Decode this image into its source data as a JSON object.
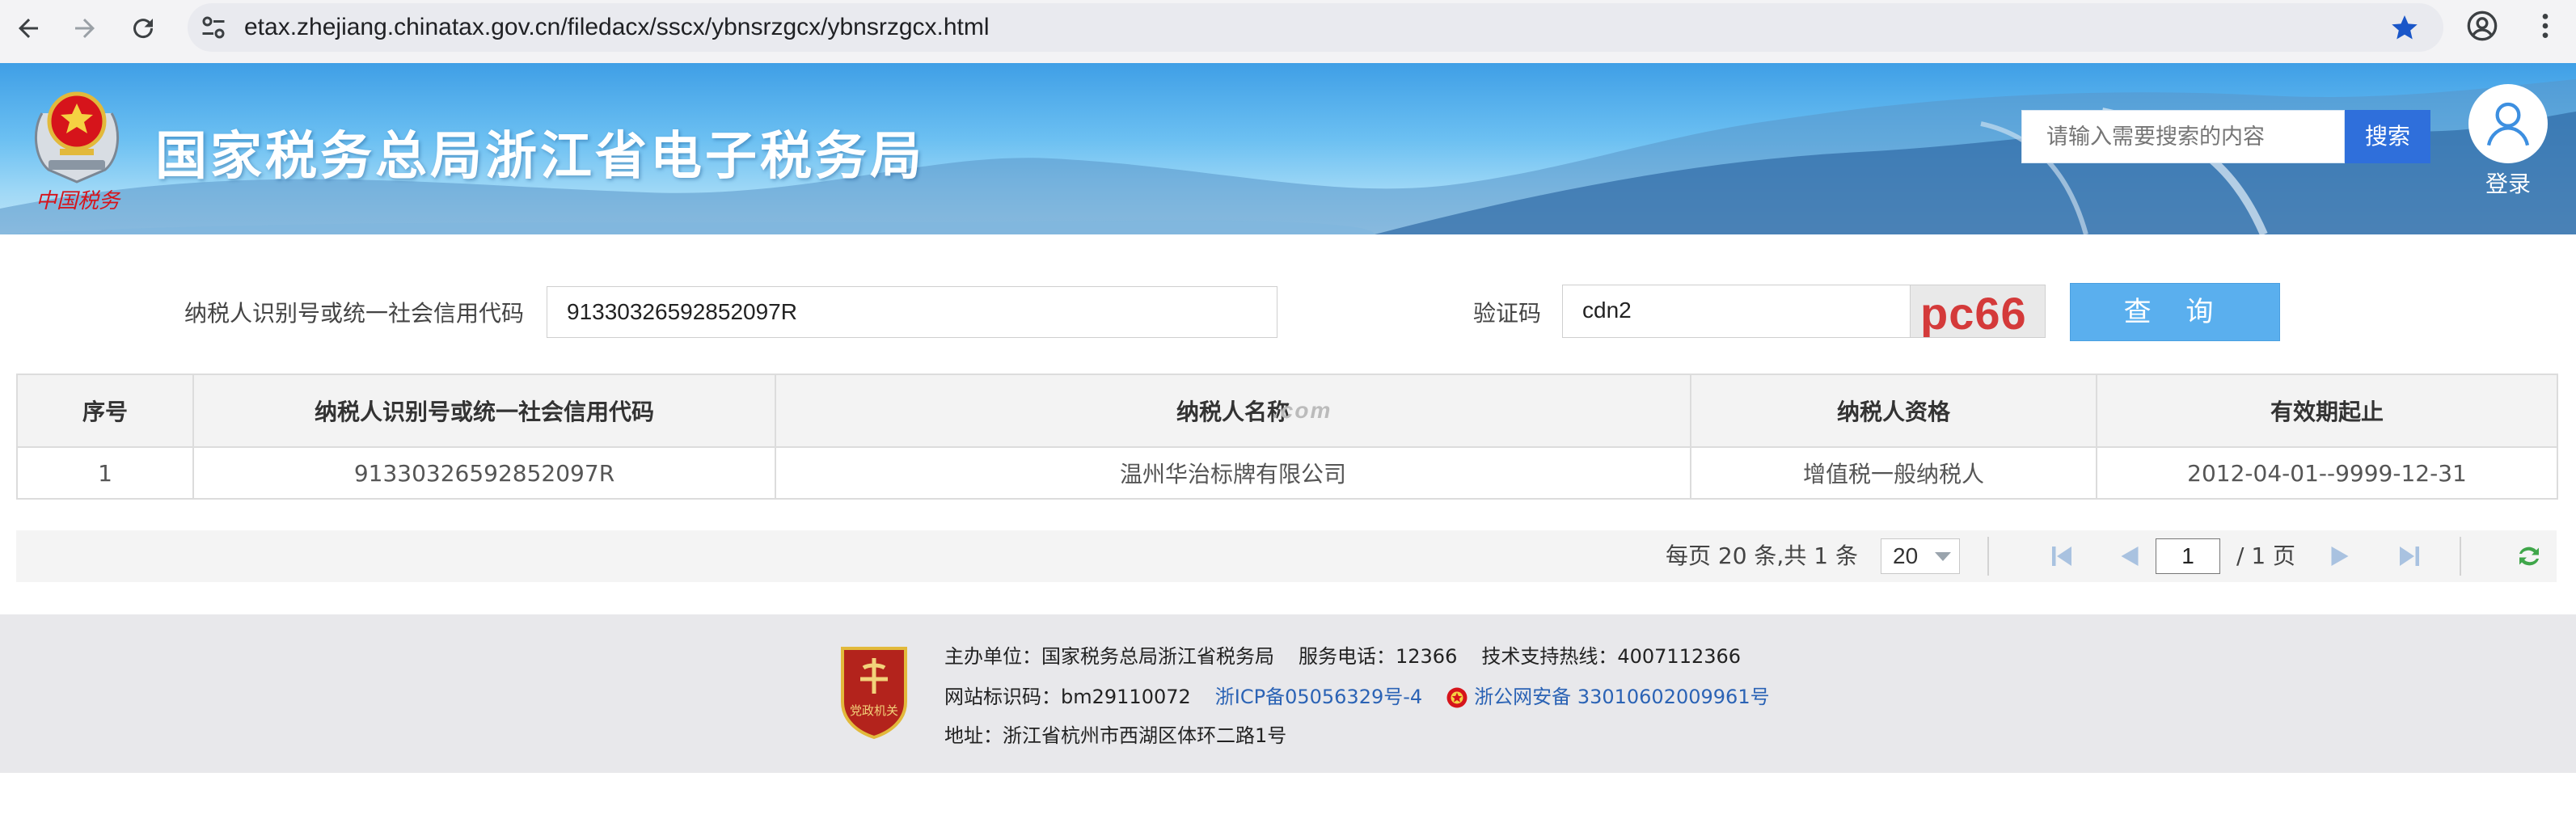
{
  "browser": {
    "url": "etax.zhejiang.chinatax.gov.cn/filedacx/sscx/ybnsrzgcx/ybnsrzgcx.html"
  },
  "header": {
    "slogan": "中国税务",
    "title": "国家税务总局浙江省电子税务局",
    "search_placeholder": "请输入需要搜索的内容",
    "search_button": "搜索",
    "login_label": "登录"
  },
  "form": {
    "taxpayer_id_label": "纳税人识别号或统一社会信用代码",
    "taxpayer_id_value": "91330326592852097R",
    "captcha_label": "验证码",
    "captcha_value": "cdn2",
    "captcha_image_text": "pc66",
    "query_button": "查 询"
  },
  "table": {
    "columns": [
      "序号",
      "纳税人识别号或统一社会信用代码",
      "纳税人名称",
      "纳税人资格",
      "有效期起止"
    ],
    "rows": [
      [
        "1",
        "91330326592852097R",
        "温州华治标牌有限公司",
        "增值税一般纳税人",
        "2012-04-01--9999-12-31"
      ]
    ],
    "watermark": ".com"
  },
  "pagination": {
    "summary": "每页 20 条,共 1 条",
    "page_size": "20",
    "current_page": "1",
    "total_pages": "/ 1 页"
  },
  "footer": {
    "line1": {
      "host": "主办单位：国家税务总局浙江省税务局",
      "service": "服务电话：12366",
      "support": "技术支持热线：4007112366"
    },
    "line2": {
      "site_id": "网站标识码：bm29110072",
      "icp": "浙ICP备05056329号-4",
      "police": "浙公网安备 33010602009961号"
    },
    "line3": {
      "address": "地址：浙江省杭州市西湖区体环二路1号"
    },
    "badge_text": "党政机关"
  },
  "colors": {
    "banner_top": "#3f9fe6",
    "search_button": "#2f6fdb",
    "query_button": "#5aafee",
    "link": "#2b63b5",
    "footer_bg": "#e8e8eb"
  }
}
